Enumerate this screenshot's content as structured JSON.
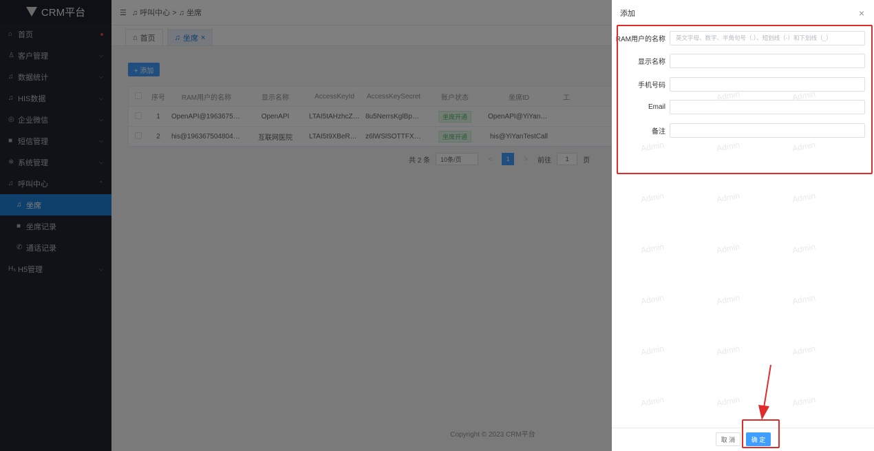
{
  "app": {
    "title": "CRM平台"
  },
  "sidebar": {
    "items": [
      {
        "icon": "home-icon",
        "glyph": "⌂",
        "label": "首页"
      },
      {
        "icon": "user-icon",
        "glyph": "♙",
        "label": "客户管理"
      },
      {
        "icon": "chart-icon",
        "glyph": "♫",
        "label": "数据统计"
      },
      {
        "icon": "headset-icon",
        "glyph": "♫",
        "label": "HIS数据"
      },
      {
        "icon": "wechat-icon",
        "glyph": "◎",
        "label": "企业微信"
      },
      {
        "icon": "message-icon",
        "glyph": "■",
        "label": "短信管理"
      },
      {
        "icon": "settings-icon",
        "glyph": "※",
        "label": "系统管理"
      },
      {
        "icon": "headset-icon",
        "glyph": "♫",
        "label": "呼叫中心"
      },
      {
        "icon": "headset-icon",
        "glyph": "♫",
        "label": "坐席"
      },
      {
        "icon": "record-icon",
        "glyph": "■",
        "label": "坐席记录"
      },
      {
        "icon": "phone-icon",
        "glyph": "✆",
        "label": "通话记录"
      },
      {
        "icon": "h5-icon",
        "glyph": "H₅",
        "label": "H5管理"
      }
    ]
  },
  "header": {
    "menu_toggle": "☰",
    "breadcrumb": [
      "呼叫中心",
      "坐席"
    ],
    "breadcrumb_sep": ">"
  },
  "tabs": [
    {
      "label": "首页"
    },
    {
      "label": "坐席",
      "close": "×"
    }
  ],
  "toolbar": {
    "add_label": "+ 添加"
  },
  "table": {
    "columns": [
      "序号",
      "RAM用户的名称",
      "显示名称",
      "AccessKeyId",
      "AccessKeySecret",
      "账户状态",
      "坐席ID",
      "工"
    ],
    "rows": [
      [
        "1",
        "OpenAPI@19636750...",
        "OpenAPI",
        "LTAI5tAHzhcZNK...",
        "8u5NerrsKglBpM4q...",
        "坐席开通",
        "OpenAPI@YiYanTes...",
        ""
      ],
      [
        "2",
        "his@1963675048044...",
        "互联网医院",
        "LTAI5t9XBeRdjGV...",
        "z6lWSlSOTTFX41D...",
        "坐席开通",
        "his@YiYanTestCall",
        ""
      ]
    ]
  },
  "pagination": {
    "total": "共 2 条",
    "page_size": "10条/页",
    "prev": "<",
    "current": "1",
    "next": ">",
    "goto_label": "前往",
    "goto_value": "1",
    "page_unit": "页"
  },
  "footer": {
    "copyright": "Copyright © 2023 CRM平台"
  },
  "drawer": {
    "title": "添加",
    "close": "×",
    "fields": [
      {
        "label": "RAM用户的名称",
        "placeholder": "英文字母、数字、半角句号（.）、短划线（-）和下划线（_）"
      },
      {
        "label": "显示名称",
        "placeholder": ""
      },
      {
        "label": "手机号码",
        "placeholder": ""
      },
      {
        "label": "Email",
        "placeholder": ""
      },
      {
        "label": "备注",
        "placeholder": ""
      }
    ],
    "watermark": "Admin",
    "cancel_label": "取 消",
    "confirm_label": "确 定"
  },
  "colors": {
    "sidebar_bg": "#212431",
    "accent": "#409eff",
    "highlight": "#e02b2b"
  }
}
